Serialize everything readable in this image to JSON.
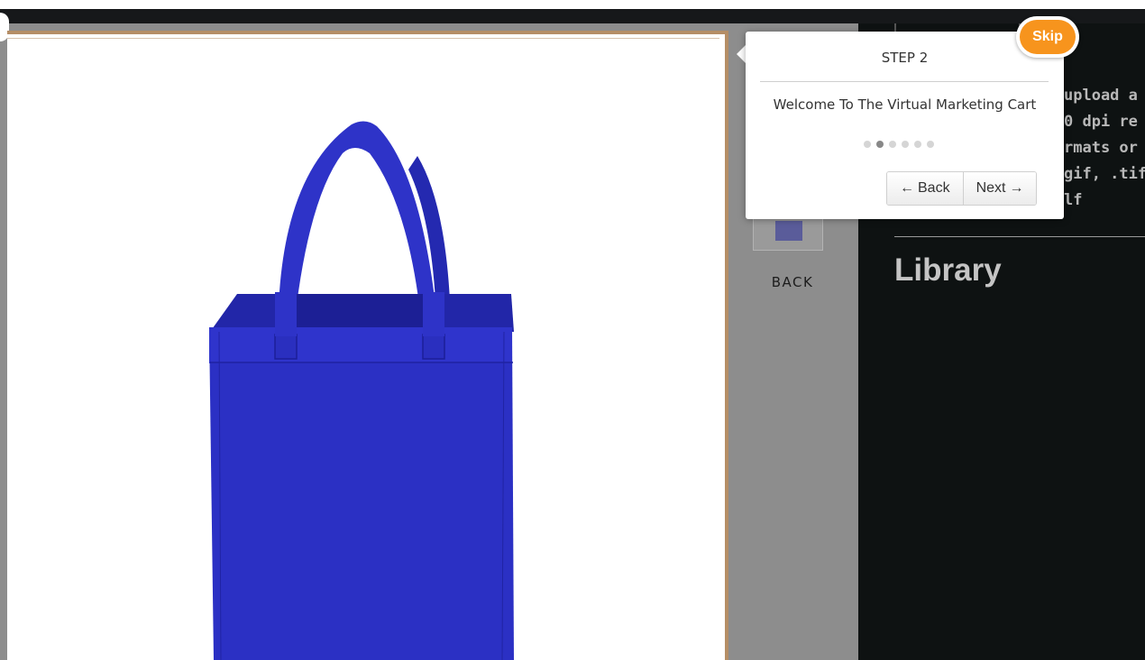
{
  "thumbnail": {
    "label": "BACK"
  },
  "upload_panel": {
    "lines": [
      "upload a",
      "0 dpi re",
      "rmats or",
      "gif, .tiff,",
      "lf"
    ]
  },
  "library": {
    "heading": "Library"
  },
  "tour": {
    "title": "STEP 2",
    "content": "Welcome To The Virtual Marketing Cart",
    "dots": 6,
    "active_dot": 2,
    "back_label": "Back",
    "next_label": "Next",
    "skip_label": "Skip"
  },
  "colors": {
    "bag": "#2b2fc0",
    "skip": "#f7941d",
    "right_panel": "#0e1212",
    "canvas_border": "#b58e66"
  }
}
